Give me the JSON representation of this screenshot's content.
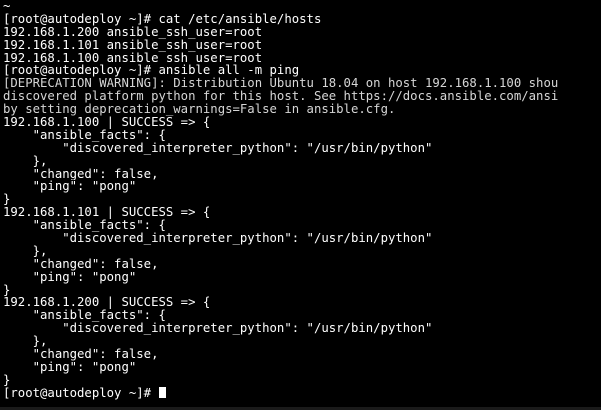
{
  "terminal": {
    "lines": [
      "~",
      "[root@autodeploy ~]# cat /etc/ansible/hosts",
      "192.168.1.200 ansible_ssh_user=root",
      "192.168.1.101 ansible_ssh_user=root",
      "192.168.1.100 ansible_ssh_user=root",
      "[root@autodeploy ~]# ansible all -m ping",
      "[DEPRECATION WARNING]: Distribution Ubuntu 18.04 on host 192.168.1.100 shou",
      "discovered platform python for this host. See https://docs.ansible.com/ansi",
      "by setting deprecation_warnings=False in ansible.cfg.",
      "192.168.1.100 | SUCCESS => {",
      "    \"ansible_facts\": {",
      "        \"discovered_interpreter_python\": \"/usr/bin/python\"",
      "    },",
      "    \"changed\": false,",
      "    \"ping\": \"pong\"",
      "}",
      "192.168.1.101 | SUCCESS => {",
      "    \"ansible_facts\": {",
      "        \"discovered_interpreter_python\": \"/usr/bin/python\"",
      "    },",
      "    \"changed\": false,",
      "    \"ping\": \"pong\"",
      "}",
      "192.168.1.200 | SUCCESS => {",
      "    \"ansible_facts\": {",
      "        \"discovered_interpreter_python\": \"/usr/bin/python\"",
      "    },",
      "    \"changed\": false,",
      "    \"ping\": \"pong\"",
      "}"
    ],
    "prompt": "[root@autodeploy ~]# "
  },
  "colors": {
    "background": "#000000",
    "foreground": "#ffffff",
    "warning": "#d6d6d6"
  }
}
